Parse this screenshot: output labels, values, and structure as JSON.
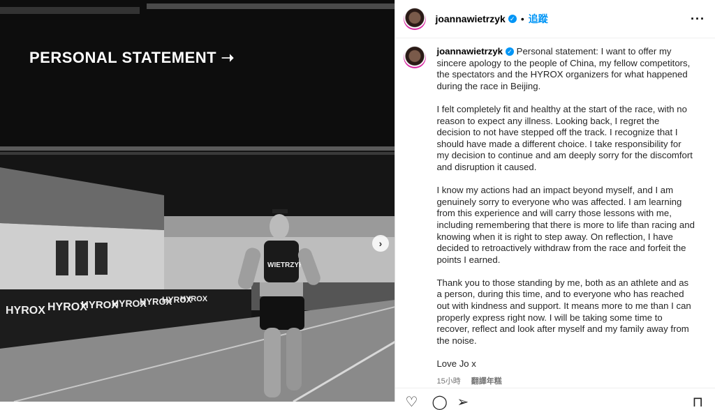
{
  "media": {
    "overlay_title": "PERSONAL STATEMENT ➝",
    "next_icon": "chevron-right-icon",
    "banners": [
      "HYROX",
      "HYROX",
      "HYROX",
      "HYROX",
      "HYROX",
      "HYROX",
      "HYROX"
    ],
    "jersey_text": "WIETRZYK"
  },
  "header": {
    "username": "joannawietrzyk",
    "separator": "•",
    "follow_label": "追蹤",
    "more_label": "···"
  },
  "caption": {
    "username": "joannawietrzyk",
    "paragraphs": [
      "Personal statement: I want to offer my sincere apology to the people of China, my fellow competitors, the spectators and the HYROX organizers for what happened during the race in Beijing.",
      "I felt completely fit and healthy at the start of the race, with no reason to expect any illness. Looking back, I regret the decision to not have stepped off the track. I recognize that I should have made a different choice. I take responsibility for my decision to continue and am deeply sorry for the discomfort and disruption it caused.",
      "I know my actions had an impact beyond myself, and I am genuinely sorry to everyone who was affected. I am learning from this experience and will carry those lessons with me, including remembering that there is more to life than racing and knowing when it is right to step away. On reflection, I have decided to retroactively withdraw from the race and forfeit the points I earned.",
      "Thank you to those standing by me, both as an athlete and as a person, during this time, and to everyone who has reached out with kindness and support. It means more to me than I can properly express right now. I will be taking some time to recover, reflect and look after myself and my family away from the noise.",
      "Love Jo x"
    ],
    "time_ago": "15小時",
    "translate_label": "翻譯年糕"
  },
  "actions": {
    "like_icon": "heart-icon",
    "comment_icon": "comment-icon",
    "share_icon": "share-icon",
    "save_icon": "bookmark-icon"
  },
  "colors": {
    "accent": "#0095f6",
    "border": "#dbdbdb",
    "muted": "#737373"
  }
}
